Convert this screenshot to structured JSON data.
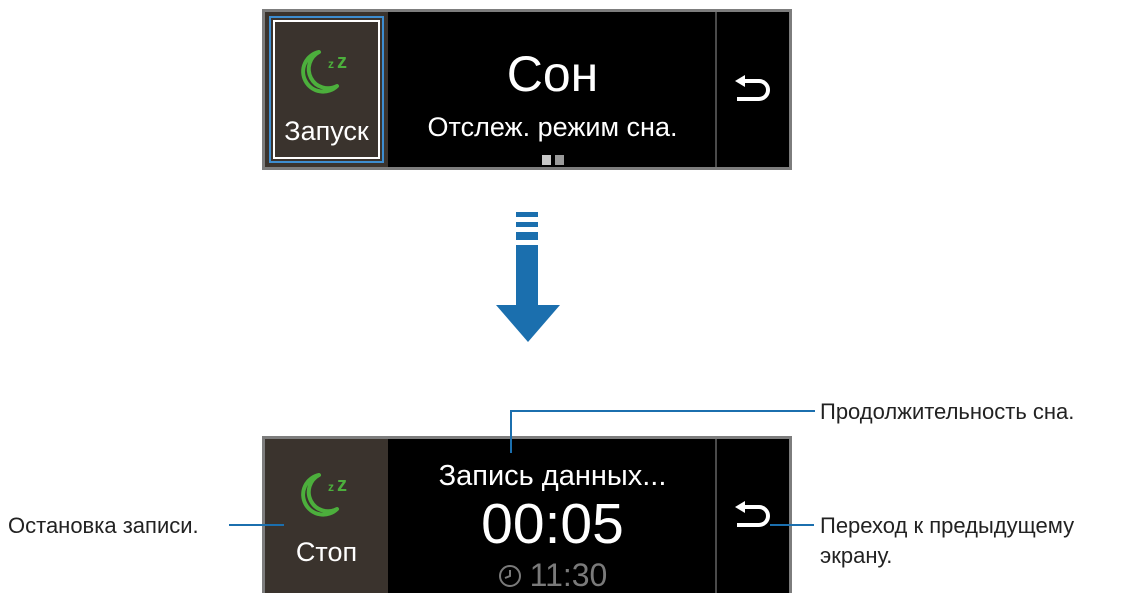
{
  "top_screen": {
    "left_button_label": "Запуск",
    "left_icon": "sleep-moon-icon",
    "title": "Сон",
    "subtitle": "Отслеж. режим сна.",
    "back_icon": "back-arrow-icon"
  },
  "bottom_screen": {
    "left_button_label": "Стоп",
    "left_icon": "sleep-moon-icon",
    "status": "Запись данных...",
    "duration": "00:05",
    "alarm_time": "11:30",
    "back_icon": "back-arrow-icon"
  },
  "callouts": {
    "duration": "Продолжительность сна.",
    "stop": "Остановка записи.",
    "back_line1": "Переход к предыдущему",
    "back_line2": "экрану."
  },
  "colors": {
    "accent_blue": "#1b6fae",
    "icon_green": "#4caf3c",
    "panel_brown": "#3a332d"
  }
}
